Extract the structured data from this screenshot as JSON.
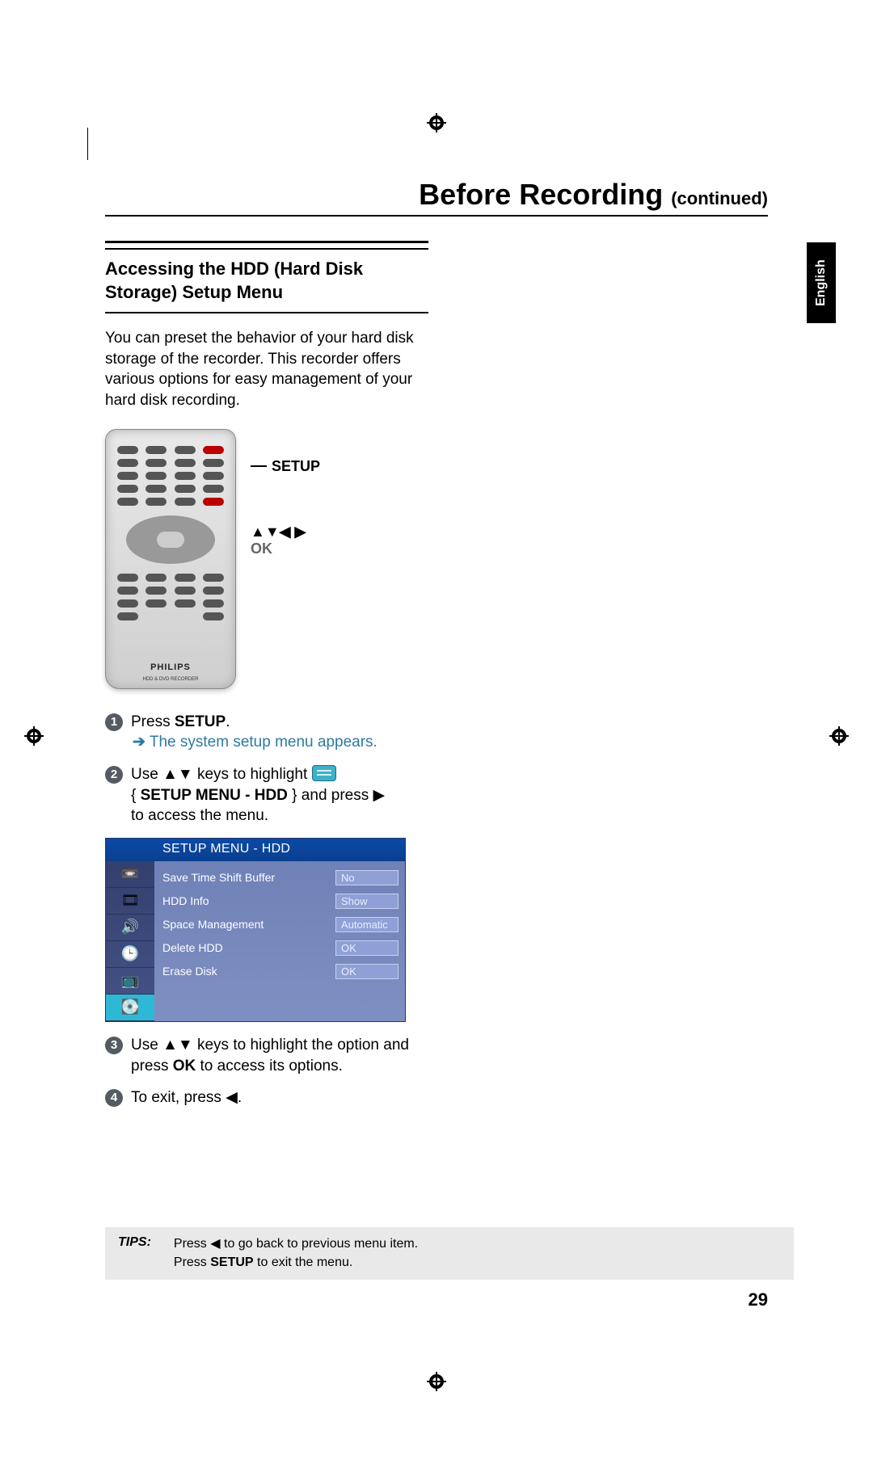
{
  "header": {
    "title": "Before Recording",
    "continued": "(continued)"
  },
  "language_tab": "English",
  "section": {
    "heading": "Accessing the HDD (Hard Disk Storage) Setup Menu",
    "intro": "You can preset the behavior of your hard disk storage of the recorder. This recorder offers various options for easy management of your hard disk recording."
  },
  "remote": {
    "brand": "PHILIPS",
    "subbrand": "HDD & DVD RECORDER",
    "labels": {
      "setup": "SETUP",
      "nav": "▲▼◀ ▶",
      "ok": "OK"
    }
  },
  "steps": {
    "s1_a": "Press ",
    "s1_b": "SETUP",
    "s1_c": ".",
    "s1_result": "The system setup menu appears.",
    "s2_a": "Use ",
    "s2_keys": "▲▼",
    "s2_b": " keys to highlight ",
    "s2_c": "{ ",
    "s2_menu": "SETUP MENU - HDD",
    "s2_d": " } and press ",
    "s2_arrow": "▶",
    "s2_e": " to access the menu.",
    "s3_a": "Use ",
    "s3_keys": "▲▼",
    "s3_b": " keys to highlight the option and press ",
    "s3_ok": "OK",
    "s3_c": " to access its options.",
    "s4_a": "To exit, press ",
    "s4_arrow": "◀",
    "s4_b": "."
  },
  "menu": {
    "title": "SETUP MENU - HDD",
    "rows": [
      {
        "label": "Save Time Shift Buffer",
        "value": "No"
      },
      {
        "label": "HDD Info",
        "value": "Show"
      },
      {
        "label": "Space Management",
        "value": "Automatic"
      },
      {
        "label": "Delete HDD",
        "value": "OK"
      },
      {
        "label": "Erase Disk",
        "value": "OK"
      }
    ],
    "icons": [
      "📼",
      "🎞",
      "🔊",
      "🕒",
      "📺",
      "💽"
    ]
  },
  "tips": {
    "label": "TIPS:",
    "line1_a": "Press ",
    "line1_arrow": "◀",
    "line1_b": " to go back to previous menu item.",
    "line2_a": "Press ",
    "line2_b": "SETUP",
    "line2_c": " to exit the menu."
  },
  "page_number": "29"
}
